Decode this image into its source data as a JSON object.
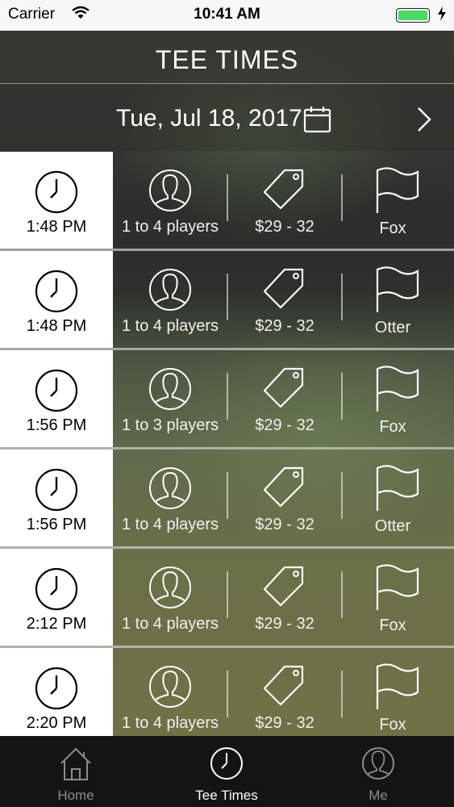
{
  "status_bar": {
    "carrier": "Carrier",
    "time": "10:41 AM"
  },
  "header": {
    "title": "TEE TIMES"
  },
  "date_bar": {
    "date": "Tue, Jul 18, 2017"
  },
  "tee_times": [
    {
      "time": "1:48 PM",
      "players": "1 to 4 players",
      "price": "$29 - 32",
      "course": "Fox"
    },
    {
      "time": "1:48 PM",
      "players": "1 to 4 players",
      "price": "$29 - 32",
      "course": "Otter"
    },
    {
      "time": "1:56 PM",
      "players": "1 to 3 players",
      "price": "$29 - 32",
      "course": "Fox"
    },
    {
      "time": "1:56 PM",
      "players": "1 to 4 players",
      "price": "$29 - 32",
      "course": "Otter"
    },
    {
      "time": "2:12 PM",
      "players": "1 to 4 players",
      "price": "$29 - 32",
      "course": "Fox"
    },
    {
      "time": "2:20 PM",
      "players": "1 to 4 players",
      "price": "$29 - 32",
      "course": "Fox"
    }
  ],
  "tab_bar": {
    "tabs": [
      {
        "label": "Home",
        "icon": "home-icon"
      },
      {
        "label": "Tee Times",
        "icon": "clock-icon"
      },
      {
        "label": "Me",
        "icon": "user-icon"
      }
    ],
    "active": "Tee Times"
  },
  "colors": {
    "battery": "#4cd964",
    "tab_bar": "#141414",
    "time_cell": "#ffffff"
  }
}
